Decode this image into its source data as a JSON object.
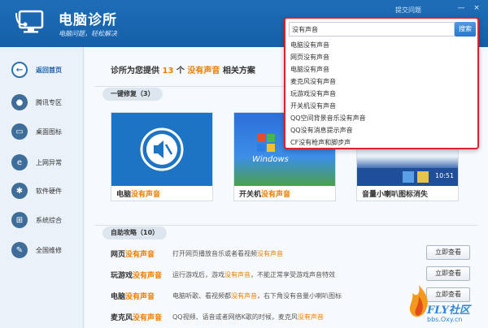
{
  "header": {
    "app_title": "电脑诊所",
    "slogan": "电脑问题，轻松解决",
    "feedback": "提交问题",
    "win_min": "—",
    "win_close": "×"
  },
  "sidebar": {
    "items": [
      {
        "label": "返回首页",
        "icon": "back-arrow-icon"
      },
      {
        "label": "腾讯专区",
        "icon": "qq-penguin-icon"
      },
      {
        "label": "桌面图标",
        "icon": "monitor-icon"
      },
      {
        "label": "上网异常",
        "icon": "ie-icon"
      },
      {
        "label": "软件硬件",
        "icon": "gear-icon"
      },
      {
        "label": "系统综合",
        "icon": "windows-icon"
      },
      {
        "label": "全国维修",
        "icon": "wrench-icon"
      }
    ]
  },
  "main": {
    "result_prefix": "诊所为您提供",
    "result_count": "13",
    "result_unit": "个",
    "result_query": "没有声音",
    "result_suffix": "相关方案",
    "quick_fix": "一键修复（3）",
    "cards": [
      {
        "title_a": "电脑",
        "title_b": "没有声音",
        "title_c": ""
      },
      {
        "title_a": "开关机",
        "title_b": "没有声音",
        "title_c": ""
      },
      {
        "title_a": "音量小喇叭图标消失",
        "title_b": "",
        "title_c": ""
      }
    ],
    "card2_logo": "Windows",
    "card3_time": "10:51",
    "guides_label": "自助攻略（10）",
    "guides": [
      {
        "title_a": "网页",
        "title_b": "没有声音",
        "desc_a": "打开网页播放音乐或者看视频",
        "desc_b": "没有声音",
        "desc_c": "",
        "btn": "立即查看"
      },
      {
        "title_a": "玩游戏",
        "title_b": "没有声音",
        "desc_a": "运行游戏后，游戏",
        "desc_b": "没有声音",
        "desc_c": "，不能正常享受游戏声音特效",
        "btn": "立即查看"
      },
      {
        "title_a": "电脑",
        "title_b": "没有声音",
        "desc_a": "电脑听歌、看视频都",
        "desc_b": "没有声音",
        "desc_c": "，右下角没有音量小喇叭图标",
        "btn": "立即查看"
      },
      {
        "title_a": "麦克风",
        "title_b": "没有声音",
        "desc_a": "QQ视频、语音或者网络K歌的时候，麦克风",
        "desc_b": "没有声音",
        "desc_c": "",
        "btn": ""
      }
    ]
  },
  "search": {
    "value": "没有声音",
    "button": "搜索",
    "suggestions": [
      "电脑没有声音",
      "网页没有声音",
      "电脑没有声音",
      "麦克风没有声音",
      "玩游戏没有声音",
      "开关机没有声音",
      "QQ空间背景音乐没有声音",
      "QQ没有消息提示声音",
      "CF没有枪声和脚步声"
    ]
  },
  "watermark": {
    "text": "FLY社区",
    "url": "bbs.Oxy.cn"
  },
  "colors": {
    "header_blue": "#1560a8",
    "highlight": "#f07d00",
    "search_border": "#d9232e"
  }
}
